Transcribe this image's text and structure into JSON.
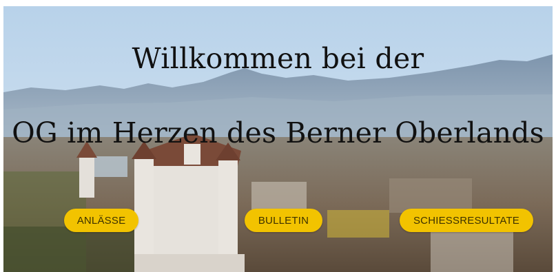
{
  "hero": {
    "headline_line1": "Willkommen bei der",
    "headline_line2": "OG im Herzen des Berner Oberlands",
    "image_name": "thun-castle-panorama",
    "accent_color": "#f2c300"
  },
  "nav_buttons": [
    {
      "label": "ANLÄSSE"
    },
    {
      "label": "BULLETIN"
    },
    {
      "label": "SCHIESSRESULTATE"
    }
  ]
}
